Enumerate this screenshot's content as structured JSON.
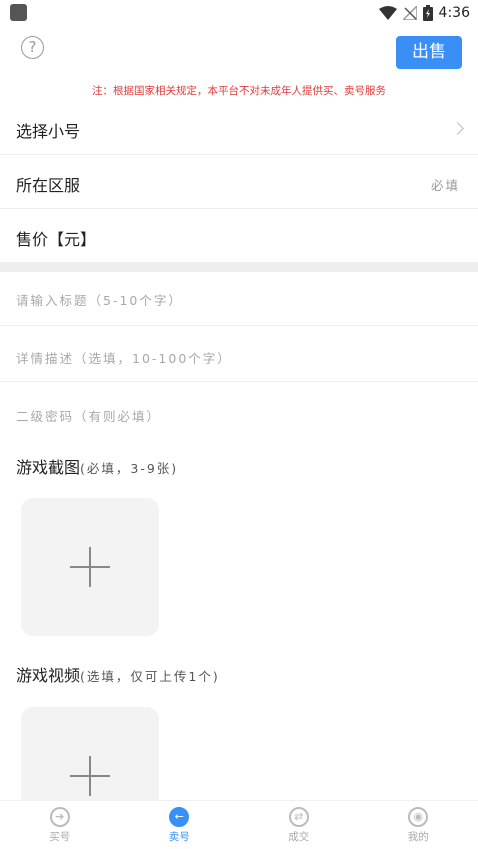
{
  "status_bar": {
    "time": "4:36"
  },
  "header": {
    "help_glyph": "?",
    "sell_label": "出售"
  },
  "notice": "注：根据国家相关规定，本平台不对未成年人提供买、卖号服务",
  "rows": [
    {
      "label": "选择小号",
      "hint": "",
      "chevron": true
    },
    {
      "label": "所在区服",
      "hint": "必填",
      "chevron": false
    },
    {
      "label": "售价【元】",
      "hint": "",
      "chevron": false
    }
  ],
  "inputs": {
    "title_placeholder": "请输入标题（5-10个字）",
    "desc_placeholder": "详情描述（选填，10-100个字）",
    "password_placeholder": "二级密码（有则必填）"
  },
  "screenshots": {
    "title": "游戏截图",
    "sub": "(必填，3-9张)"
  },
  "video": {
    "title": "游戏视频",
    "sub": "(选填，仅可上传1个)"
  },
  "nav": [
    {
      "label": "买号",
      "icon": "buy-icon",
      "glyph": "➔",
      "active": false
    },
    {
      "label": "卖号",
      "icon": "sell-icon",
      "glyph": "←",
      "active": true
    },
    {
      "label": "成交",
      "icon": "deal-icon",
      "glyph": "⇄",
      "active": false
    },
    {
      "label": "我的",
      "icon": "profile-icon",
      "glyph": "◉",
      "active": false
    }
  ],
  "colors": {
    "accent": "#3a8ff7",
    "notice": "#e03a3a"
  }
}
